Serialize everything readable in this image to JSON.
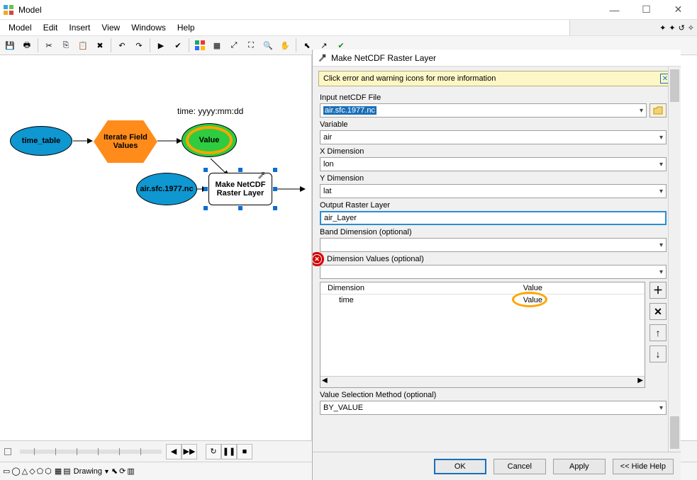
{
  "window": {
    "title": "Model"
  },
  "menus": [
    "Model",
    "Edit",
    "Insert",
    "View",
    "Windows",
    "Help"
  ],
  "canvas": {
    "annotation": "time: yyyy:mm:dd",
    "nodes": {
      "time_table": "time_table",
      "iterate": "Iterate Field Values",
      "value": "Value",
      "air": "air.sfc.1977.nc",
      "tool": "Make NetCDF Raster Layer"
    }
  },
  "dialog": {
    "title": "Make NetCDF Raster Layer",
    "info": "Click error and warning icons for more information",
    "fields": {
      "input_label": "Input netCDF File",
      "input_value": "air.sfc.1977.nc",
      "variable_label": "Variable",
      "variable_value": "air",
      "xdim_label": "X Dimension",
      "xdim_value": "lon",
      "ydim_label": "Y Dimension",
      "ydim_value": "lat",
      "outraster_label": "Output Raster Layer",
      "outraster_value": "air_Layer",
      "banddim_label": "Band Dimension (optional)",
      "banddim_value": "",
      "dimvals_label": "Dimension Values (optional)",
      "valsel_label": "Value Selection Method (optional)",
      "valsel_value": "BY_VALUE"
    },
    "dim_table": {
      "col_dim": "Dimension",
      "col_val": "Value",
      "row_dim": "time",
      "row_val": "Value"
    },
    "buttons": {
      "ok": "OK",
      "cancel": "Cancel",
      "apply": "Apply",
      "hide": "<< Hide Help"
    }
  },
  "drawing_label": "Drawing"
}
